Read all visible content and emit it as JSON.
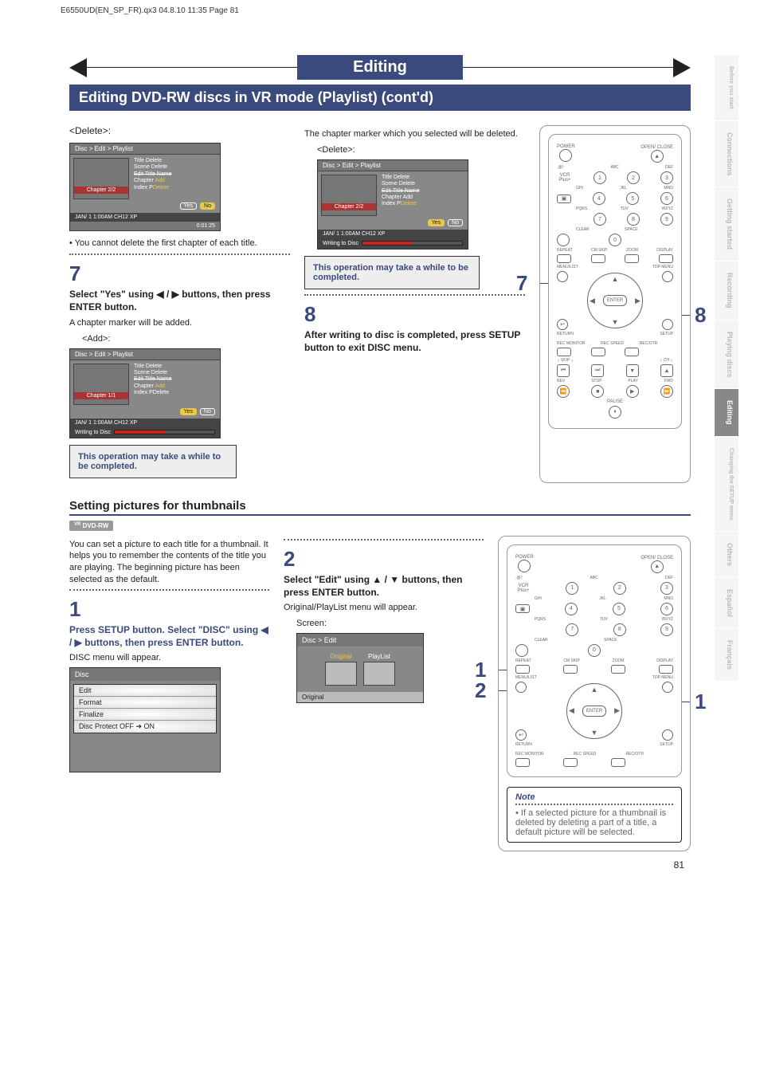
{
  "slug": "E6550UD(EN_SP_FR).qx3  04.8.10  11:35  Page 81",
  "banner_title": "Editing",
  "subbanner": "Editing DVD-RW discs in VR mode (Playlist) (cont'd)",
  "side_tabs": [
    "Before you start",
    "Connections",
    "Getting started",
    "Recording",
    "Playing discs",
    "Editing",
    "Changing the SETUP menu",
    "Others",
    "Español",
    "Français"
  ],
  "side_tab_dark_index": 5,
  "top": {
    "left": {
      "delete_heading": "<Delete>:",
      "ui1": {
        "path": "Disc > Edit > Playlist",
        "chapter": "Chapter 2/2",
        "menu": [
          "Title Delete",
          "Scene Delete",
          "Edit Title Name",
          "Chapter",
          "Index Picture"
        ],
        "submenu": [
          "Add",
          "Delete"
        ],
        "yes": "Yes",
        "no": "No",
        "status": "JAN/ 1   1:00AM  CH12    XP",
        "time": "0:01:25"
      },
      "bullet": "• You cannot delete the first chapter of each title.",
      "step7_num": "7",
      "step7_text": "Select \"Yes\" using ◀ / ▶ buttons, then press ENTER button.",
      "step7_body": "A chapter marker will be added.",
      "add_heading": "<Add>:",
      "ui2": {
        "path": "Disc > Edit > Playlist",
        "chapter": "Chapter 1/1",
        "menu": [
          "Title Delete",
          "Scene Delete",
          "Edit Title Name",
          "Chapter",
          "Index Picture"
        ],
        "submenu": [
          "Add",
          "Delete"
        ],
        "yes": "Yes",
        "no": "No",
        "status": "JAN/ 1   1:00AM  CH12    XP",
        "writing": "Writing to Disc"
      },
      "note1": "This operation may take a while to be completed."
    },
    "mid": {
      "intro": "The chapter marker which you selected will be deleted.",
      "delete_heading": "<Delete>:",
      "ui3": {
        "path": "Disc > Edit > Playlist",
        "chapter": "Chapter 2/2",
        "menu": [
          "Title Delete",
          "Scene Delete",
          "Edit Title Name",
          "Chapter",
          "Index Picture"
        ],
        "submenu": [
          "Add",
          "Delete"
        ],
        "yes": "Yes",
        "no": "No",
        "status": "JAN/ 1   1:00AM  CH12    XP",
        "writing": "Writing to Disc"
      },
      "note2": "This operation may take a while to be completed.",
      "step8_num": "8",
      "step8_text": "After writing to disc is completed, press SETUP button to exit DISC menu."
    },
    "callouts": {
      "c7": "7",
      "c8": "8"
    }
  },
  "remote": {
    "top_labels": {
      "power": "POWER",
      "open": "OPEN/\nCLOSE",
      "vcr": "VCR Plus+",
      "source": "SOURCE",
      "clear": "CLEAR",
      "space": "SPACE",
      "repeat": "REPEAT",
      "cmskip": "CM SKIP",
      "zoom": "ZOOM",
      "display": "DISPLAY",
      "menulist": "MENU/LIST",
      "topmenu": "TOP MENU",
      "return": "RETURN",
      "setup": "SETUP",
      "rec_monitor": "REC\nMONITOR",
      "rec_speed": "REC\nSPEED",
      "rec_otr": "REC/OTR",
      "skip": "SKIP",
      "ch": "CH",
      "rev": "REV",
      "stop": "STOP",
      "play": "PLAY",
      "fwd": "FWD",
      "pause": "PAUSE"
    },
    "num_labels": [
      ".@/:",
      "ABC",
      "DEF",
      "GHI",
      "JKL",
      "MNO",
      "PQRS",
      "TUV",
      "WXYZ"
    ],
    "nums": [
      "1",
      "2",
      "3",
      "4",
      "5",
      "6",
      "7",
      "8",
      "9",
      "0"
    ],
    "enter": "ENTER"
  },
  "section2": {
    "heading": "Setting pictures for thumbnails",
    "badge": "DVD-RW",
    "badge_sup": "VR",
    "intro": "You can set a picture to each title for a thumbnail. It helps you to remember the contents of the title you are playing. The beginning picture has been selected as the default.",
    "step1_num": "1",
    "step1_text": "Press SETUP button. Select \"DISC\" using ◀ / ▶ buttons, then press ENTER button.",
    "step1_body": "DISC menu will appear.",
    "disc_menu": {
      "hdr": "Disc",
      "items": [
        "Edit",
        "Format",
        "Finalize",
        "Disc Protect OFF ➔ ON"
      ]
    },
    "step2_num": "2",
    "step2_text": "Select \"Edit\" using ▲ / ▼ buttons, then press ENTER button.",
    "step2_body": "Original/PlayList menu will appear.",
    "screen": "Screen:",
    "edit_menu": {
      "hdr": "Disc > Edit",
      "orig": "Original",
      "play": "PlayList",
      "ft": "Original"
    },
    "callouts": {
      "c1a": "1",
      "c2": "2",
      "c1b": "1"
    },
    "note_title": "Note",
    "note_body": "• If a selected picture for a thumbnail is deleted by deleting a part of a title, a default picture will be selected."
  },
  "page_num": "81"
}
